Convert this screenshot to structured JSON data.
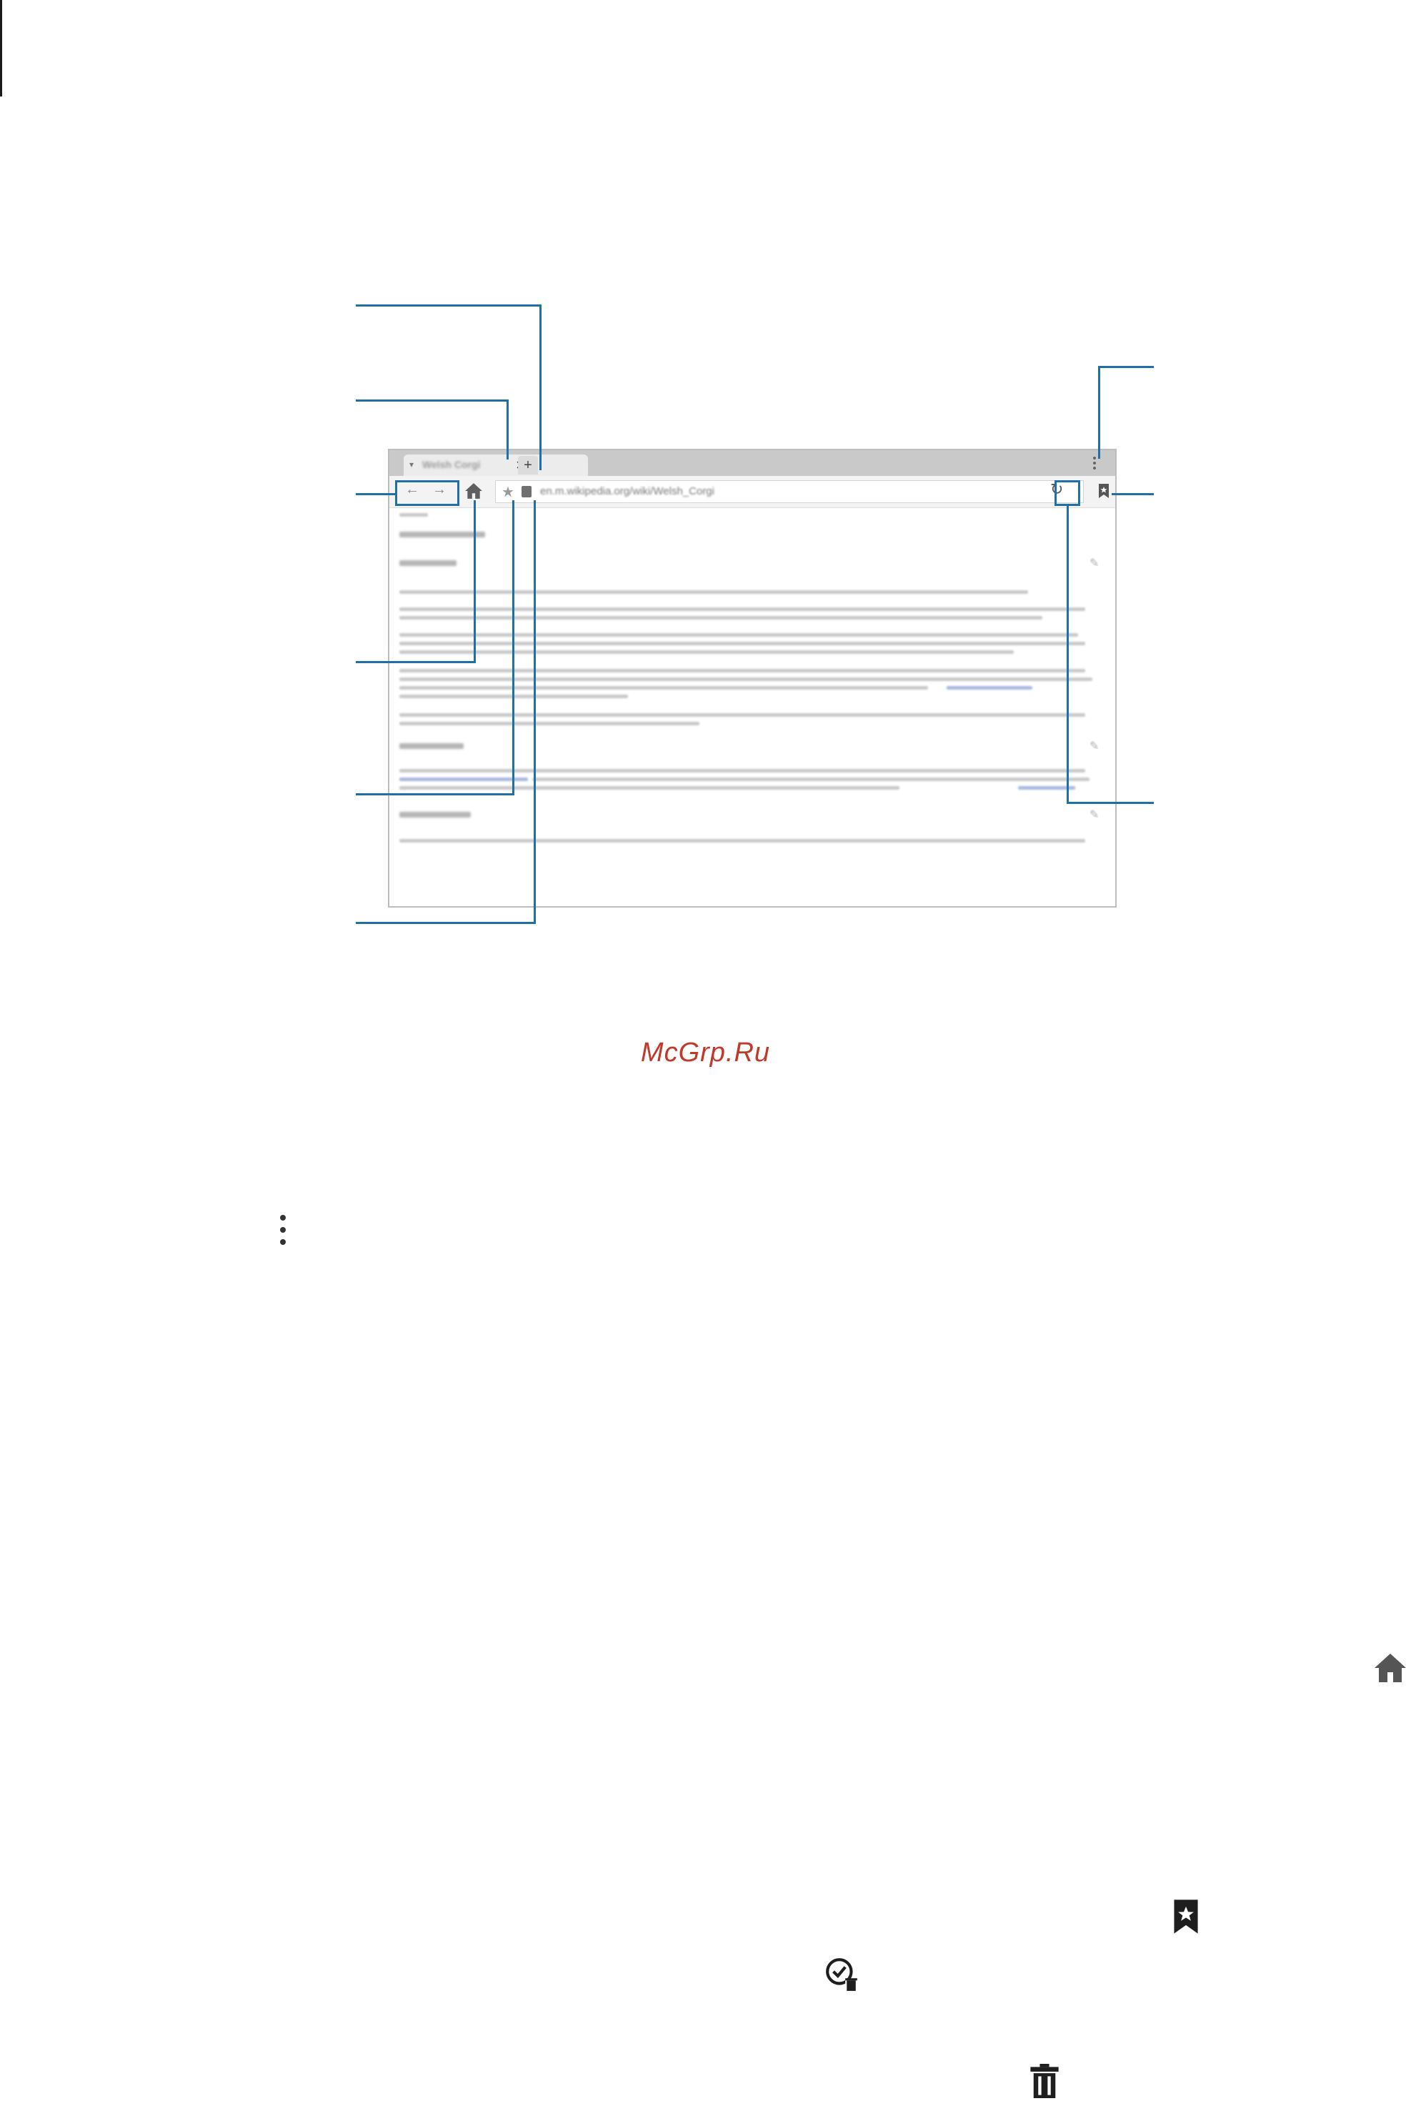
{
  "browser": {
    "tab_title": "Welsh Corgi",
    "tab_arrow": "▾",
    "close_symbol": "×",
    "new_tab_symbol": "+",
    "menu_symbol": "⋮",
    "back_symbol": "←",
    "forward_symbol": "→",
    "star_symbol": "★",
    "url": "en.m.wikipedia.org/wiki/Welsh_Corgi",
    "refresh_symbol": "↻"
  },
  "footer": {
    "watermark": "McGrp.Ru"
  },
  "icons": {
    "more_options": "vertical-dots-icon",
    "home": "home-icon",
    "bookmark": "bookmark-star-icon",
    "history_delete": "history-clock-delete-icon",
    "trash": "trash-icon"
  },
  "colors": {
    "callout": "#1f6fa8",
    "watermark": "#c0392b"
  }
}
